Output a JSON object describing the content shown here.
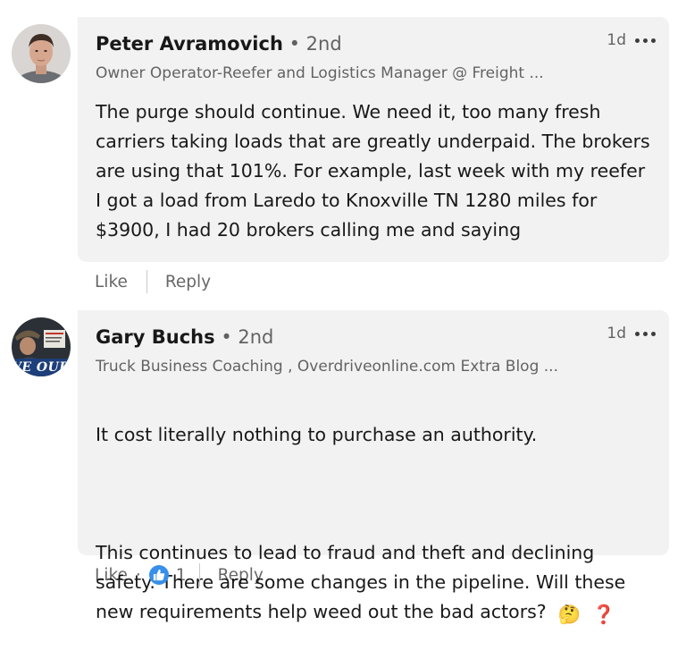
{
  "comments": [
    {
      "author": "Peter Avramovich",
      "degree": "• 2nd",
      "headline": "Owner Operator-Reefer and Logistics Manager @ Freight ...",
      "time": "1d",
      "text": "The purge should continue. We need it, too many fresh carriers taking loads that are greatly underpaid. The brokers are using that 101%. For example, last week with my reefer I got a load from Laredo to Knoxville TN 1280 miles for $3900, I had 20 brokers calling me and saying",
      "actions": {
        "like": "Like",
        "reply": "Reply"
      }
    },
    {
      "author": "Gary Buchs",
      "degree": "• 2nd",
      "headline": "Truck Business Coaching , Overdriveonline.com Extra Blog ...",
      "time": "1d",
      "text_line1": "It cost literally nothing to purchase an authority.",
      "text_para2": "This continues to lead to fraud and theft and declining safety. There are some changes in the pipeline. Will these new requirements help weed out the bad actors?",
      "emoji_1": "🤔",
      "emoji_2": "❓",
      "avatar_banner": "VE OUR",
      "actions": {
        "like": "Like",
        "dot": "·",
        "reaction_count": "1",
        "reply": "Reply"
      }
    }
  ],
  "colors": {
    "bubble": "#f2f2f2",
    "reaction_blue": "#378fe9",
    "question_red": "#d9342b"
  }
}
